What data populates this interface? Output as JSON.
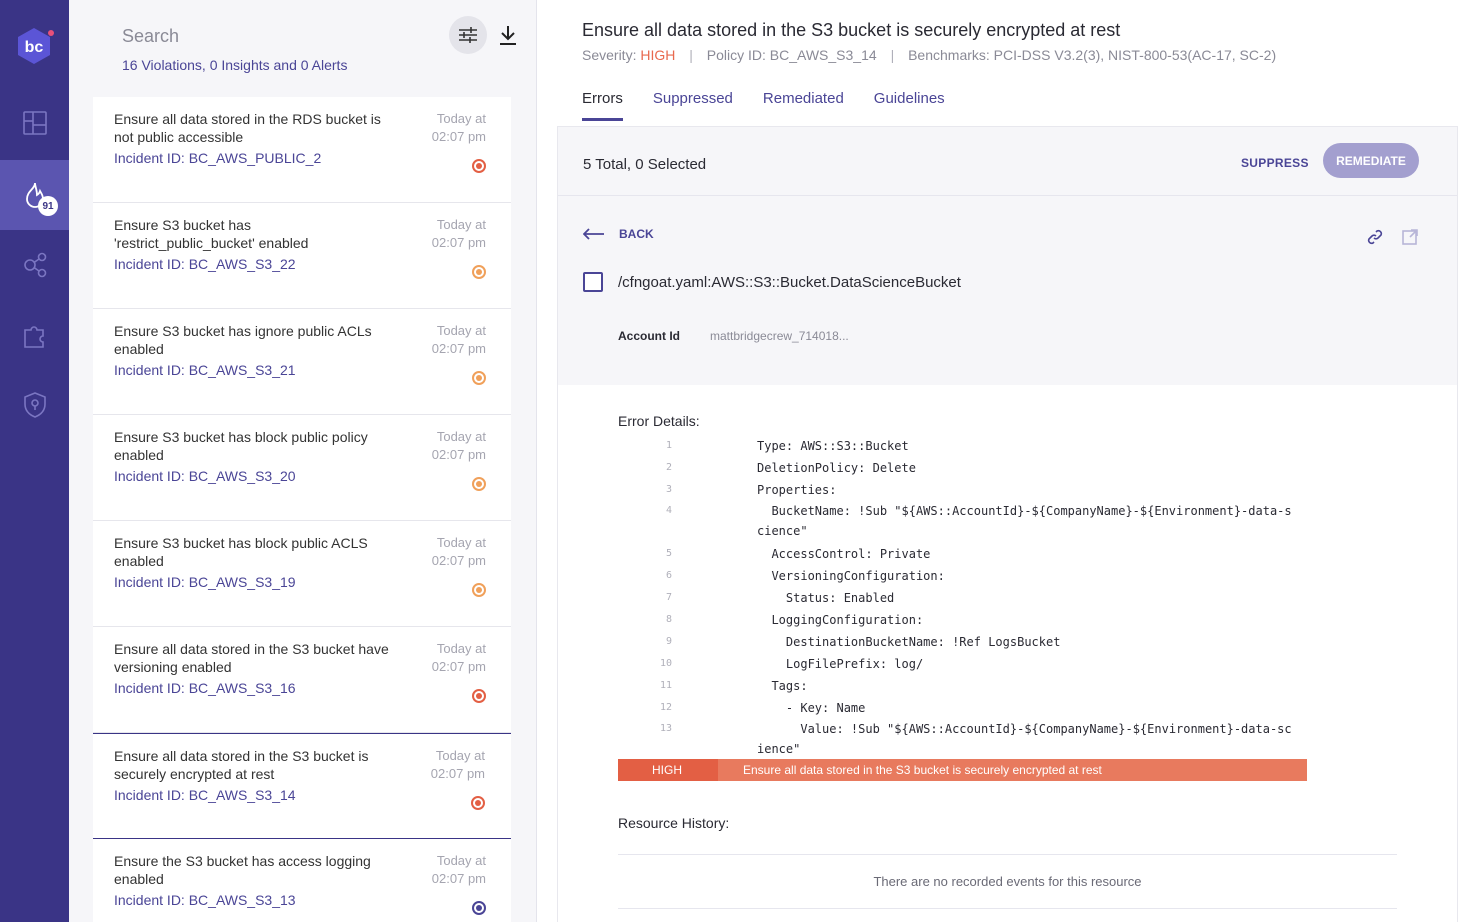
{
  "nav": {
    "badge": "91",
    "logo_text": "bc"
  },
  "list": {
    "search_placeholder": "Search",
    "summary": "16 Violations, 0 Insights and 0 Alerts",
    "items": [
      {
        "title": "Ensure all data stored in the RDS bucket is not public accessible",
        "incident": "Incident ID: BC_AWS_PUBLIC_2",
        "time_line1": "Today at",
        "time_line2": "02:07 pm",
        "severity_color": "#e35f44"
      },
      {
        "title": "Ensure S3 bucket has 'restrict_public_bucket' enabled",
        "incident": "Incident ID: BC_AWS_S3_22",
        "time_line1": "Today at",
        "time_line2": "02:07 pm",
        "severity_color": "#f0a05a"
      },
      {
        "title": "Ensure S3 bucket has ignore public ACLs enabled",
        "incident": "Incident ID: BC_AWS_S3_21",
        "time_line1": "Today at",
        "time_line2": "02:07 pm",
        "severity_color": "#f0a05a"
      },
      {
        "title": "Ensure S3 bucket has block public policy enabled",
        "incident": "Incident ID: BC_AWS_S3_20",
        "time_line1": "Today at",
        "time_line2": "02:07 pm",
        "severity_color": "#f0a05a"
      },
      {
        "title": "Ensure S3 bucket has block public ACLS enabled",
        "incident": "Incident ID: BC_AWS_S3_19",
        "time_line1": "Today at",
        "time_line2": "02:07 pm",
        "severity_color": "#f0a05a"
      },
      {
        "title": "Ensure all data stored in the S3 bucket have versioning enabled",
        "incident": "Incident ID: BC_AWS_S3_16",
        "time_line1": "Today at",
        "time_line2": "02:07 pm",
        "severity_color": "#e35f44"
      },
      {
        "title": "Ensure all data stored in the S3 bucket is securely encrypted at rest",
        "incident": "Incident ID: BC_AWS_S3_14",
        "time_line1": "Today at",
        "time_line2": "02:07 pm",
        "severity_color": "#e35f44"
      },
      {
        "title": "Ensure the S3 bucket has access logging enabled",
        "incident": "Incident ID: BC_AWS_S3_13",
        "time_line1": "Today at",
        "time_line2": "02:07 pm",
        "severity_color": "#4a4596"
      }
    ]
  },
  "detail": {
    "title": "Ensure all data stored in the S3 bucket is securely encrypted at rest",
    "severity_label": "Severity:",
    "severity": "HIGH",
    "policy": "Policy ID: BC_AWS_S3_14",
    "benchmarks": "Benchmarks: PCI-DSS V3.2(3), NIST-800-53(AC-17, SC-2)",
    "tabs": [
      "Errors",
      "Suppressed",
      "Remediated",
      "Guidelines"
    ],
    "total": "5 Total, 0 Selected",
    "suppress": "SUPPRESS",
    "remediate": "REMEDIATE",
    "back": "BACK",
    "resource": "/cfngoat.yaml:AWS::S3::Bucket.DataScienceBucket",
    "account_label": "Account Id",
    "account_value": "mattbridgecrew_714018...",
    "error_details_label": "Error Details:",
    "code": [
      {
        "n": "1",
        "text": "Type: AWS::S3::Bucket"
      },
      {
        "n": "2",
        "text": "DeletionPolicy: Delete"
      },
      {
        "n": "3",
        "text": "Properties:"
      },
      {
        "n": "4",
        "text": "  BucketName: !Sub \"${AWS::AccountId}-${CompanyName}-${Environment}-data-science\""
      },
      {
        "n": "5",
        "text": "  AccessControl: Private"
      },
      {
        "n": "6",
        "text": "  VersioningConfiguration:"
      },
      {
        "n": "7",
        "text": "    Status: Enabled"
      },
      {
        "n": "8",
        "text": "  LoggingConfiguration:"
      },
      {
        "n": "9",
        "text": "    DestinationBucketName: !Ref LogsBucket"
      },
      {
        "n": "10",
        "text": "    LogFilePrefix: log/"
      },
      {
        "n": "11",
        "text": "  Tags:"
      },
      {
        "n": "12",
        "text": "    - Key: Name"
      },
      {
        "n": "13",
        "text": "      Value: !Sub \"${AWS::AccountId}-${CompanyName}-${Environment}-data-science\""
      }
    ],
    "error_bar_severity": "HIGH",
    "error_bar_text": "Ensure all data stored in the S3 bucket is securely encrypted at rest",
    "history_label": "Resource History:",
    "history_empty": "There are no recorded events for this resource"
  }
}
